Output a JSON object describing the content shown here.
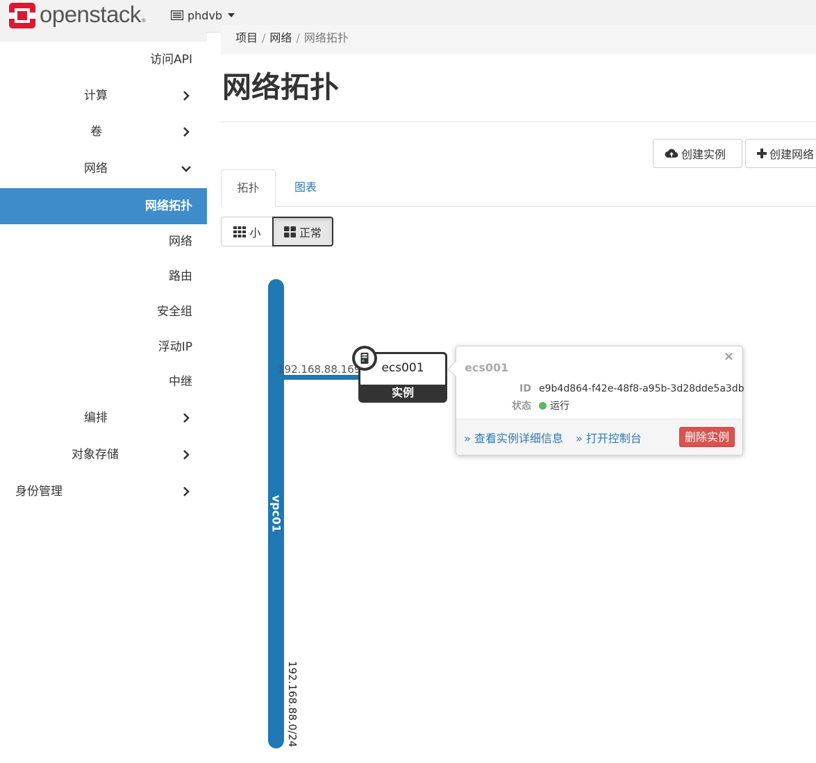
{
  "brand": {
    "name": "openstack",
    "reg": "®"
  },
  "project": {
    "name": "phdvb"
  },
  "sidebar": {
    "items": [
      {
        "label": "访问API"
      },
      {
        "label": "计算"
      },
      {
        "label": "卷"
      },
      {
        "label": "网络"
      },
      {
        "label": "网络拓扑"
      },
      {
        "label": "网络"
      },
      {
        "label": "路由"
      },
      {
        "label": "安全组"
      },
      {
        "label": "浮动IP"
      },
      {
        "label": "中继"
      },
      {
        "label": "编排"
      },
      {
        "label": "对象存储"
      },
      {
        "label": "身份管理"
      }
    ]
  },
  "breadcrumb": {
    "items": [
      "项目",
      "网络",
      "网络拓扑"
    ],
    "sep": "/"
  },
  "page": {
    "title": "网络拓扑"
  },
  "actions": {
    "create_instance": "创建实例",
    "create_network": "创建网络"
  },
  "tabs": [
    {
      "label": "拓扑"
    },
    {
      "label": "图表"
    }
  ],
  "size_toggle": {
    "small": "小",
    "normal": "正常",
    "selected": "normal"
  },
  "topology": {
    "network": {
      "name": "vpc01",
      "cidr": "192.168.88.0/24",
      "color": "#1f77b4"
    },
    "port": {
      "ip": "192.168.88.169"
    },
    "instance": {
      "name": "ecs001",
      "type": "实例"
    }
  },
  "popup": {
    "title": "ecs001",
    "close": "×",
    "id_label": "ID",
    "id_value": "e9b4d864-f42e-48f8-a95b-3d28dde5a3db",
    "status_label": "状态",
    "status_value": "运行",
    "status_color": "#5cb85c",
    "link_details": "» 查看实例详细信息",
    "link_console": "» 打开控制台",
    "delete_button": "删除实例"
  },
  "colors": {
    "accent": "#3f8ccb",
    "link": "#2a7ab8",
    "danger": "#d9534f",
    "brand_red": "#da1a32"
  }
}
